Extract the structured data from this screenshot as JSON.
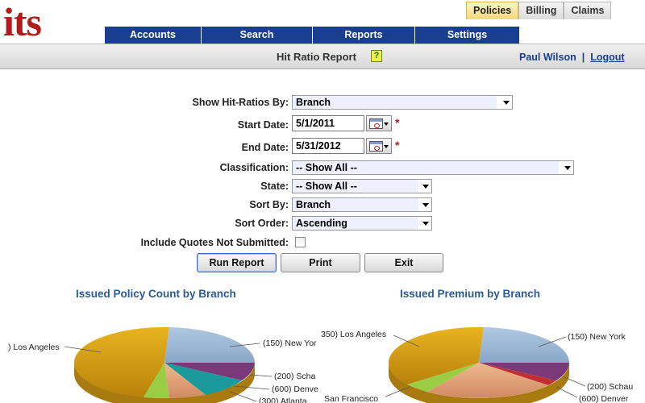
{
  "logo": "its",
  "top_tabs": [
    "Policies",
    "Billing",
    "Claims"
  ],
  "nav": [
    "Accounts",
    "Search",
    "Reports",
    "Settings"
  ],
  "header": {
    "title": "Hit Ratio Report",
    "help": "?",
    "user": "Paul Wilson",
    "separator": "|",
    "logout": "Logout"
  },
  "form": {
    "show_by_label": "Show Hit-Ratios By:",
    "show_by_value": "Branch",
    "start_label": "Start Date:",
    "start_value": "5/1/2011",
    "end_label": "End Date:",
    "end_value": "5/31/2012",
    "required_mark": "*",
    "class_label": "Classification:",
    "class_value": "-- Show All --",
    "state_label": "State:",
    "state_value": "-- Show All --",
    "sort_label": "Sort By:",
    "sort_value": "Branch",
    "order_label": "Sort Order:",
    "order_value": "Ascending",
    "include_label": "Include Quotes Not Submitted:"
  },
  "buttons": {
    "run": "Run Report",
    "print": "Print",
    "exit": "Exit"
  },
  "charts_titles": {
    "left": "Issued Policy Count by Branch",
    "right": "Issued Premium by Branch"
  },
  "colors": {
    "nav": "#1a3e90",
    "accent": "#b01c1c",
    "chart_title": "#2a5a9a"
  },
  "chart_data": [
    {
      "type": "pie",
      "title": "Issued Policy Count by Branch",
      "labels": [
        ") Los Angeles",
        "(150) New Yor",
        "(200) Scha",
        "(600) Denve",
        "(300) Atlanta"
      ]
    },
    {
      "type": "pie",
      "title": "Issued Premium by Branch",
      "labels": [
        "350) Los Angeles",
        "(150) New York",
        "(200) Schau",
        "(600) Denver",
        "San Francisco"
      ]
    }
  ]
}
